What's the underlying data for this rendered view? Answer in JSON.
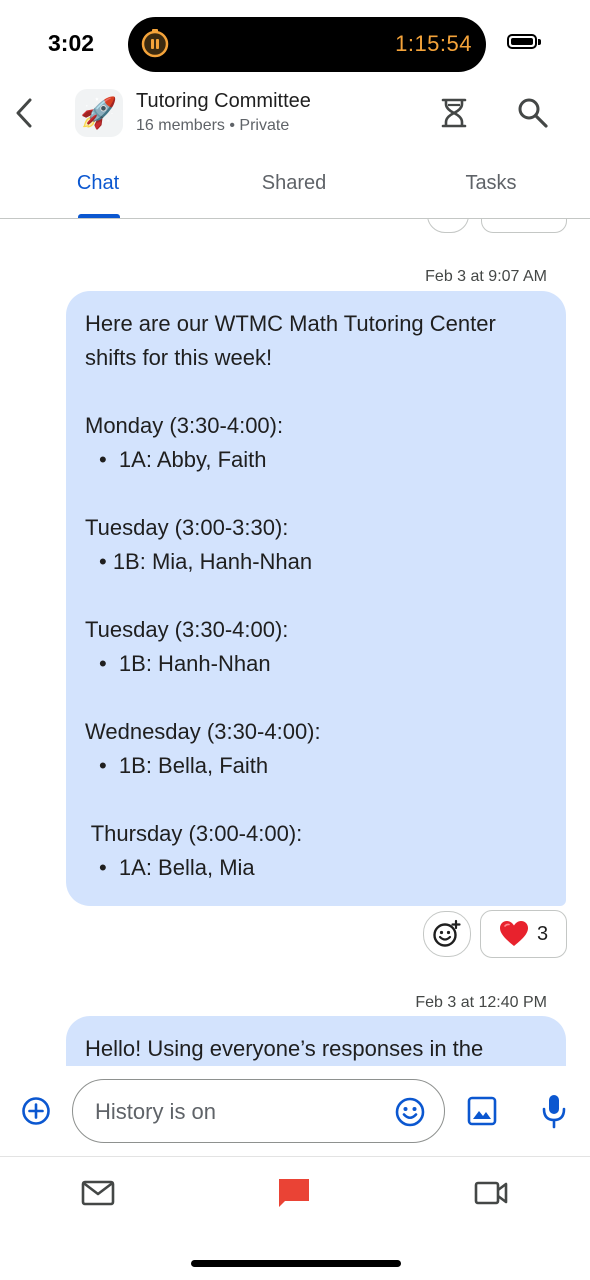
{
  "status_bar": {
    "time": "3:02",
    "timer": "1:15:54"
  },
  "header": {
    "back_icon": "chevron-left-icon",
    "group_icon": "rocket-emoji",
    "group_emoji": "🚀",
    "group_name": "Tutoring Committee",
    "group_meta": "16 members  •  Private",
    "actions": [
      "hourglass-icon",
      "search-icon"
    ]
  },
  "tabs": [
    {
      "label": "Chat",
      "active": true
    },
    {
      "label": "Shared",
      "active": false
    },
    {
      "label": "Tasks",
      "active": false
    }
  ],
  "messages": [
    {
      "timestamp": "Feb 3 at 9:07 AM",
      "lines": [
        "Here are our WTMC Math Tutoring Center",
        "shifts for this week!",
        "",
        "Monday (3:30-4:00):",
        "•  1A: Abby, Faith",
        "",
        "Tuesday (3:00-3:30):",
        "• 1B: Mia, Hanh-Nhan",
        "",
        "Tuesday (3:30-4:00):",
        "•  1B: Hanh-Nhan",
        "",
        "Wednesday (3:30-4:00):",
        "•  1B: Bella, Faith",
        "",
        " Thursday (3:00-4:00):",
        "•  1A: Bella, Mia"
      ],
      "reactions": [
        {
          "emoji": "❤️",
          "count": "3"
        }
      ]
    },
    {
      "timestamp": "Feb 3 at 12:40 PM",
      "lines": [
        "Hello! Using everyone’s responses in the"
      ]
    }
  ],
  "composer": {
    "placeholder": "History is on",
    "value": "",
    "icons": [
      "add-circle-icon",
      "emoji-icon",
      "image-icon",
      "mic-icon"
    ]
  },
  "bottom_nav": [
    "mail-icon",
    "chat-icon",
    "video-icon"
  ],
  "colors": {
    "accent": "#0b57d0",
    "bubble": "#d3e3fd",
    "timer": "#f4a33a",
    "chat_nav_active": "#ea4335",
    "heart": "#e8222d"
  }
}
